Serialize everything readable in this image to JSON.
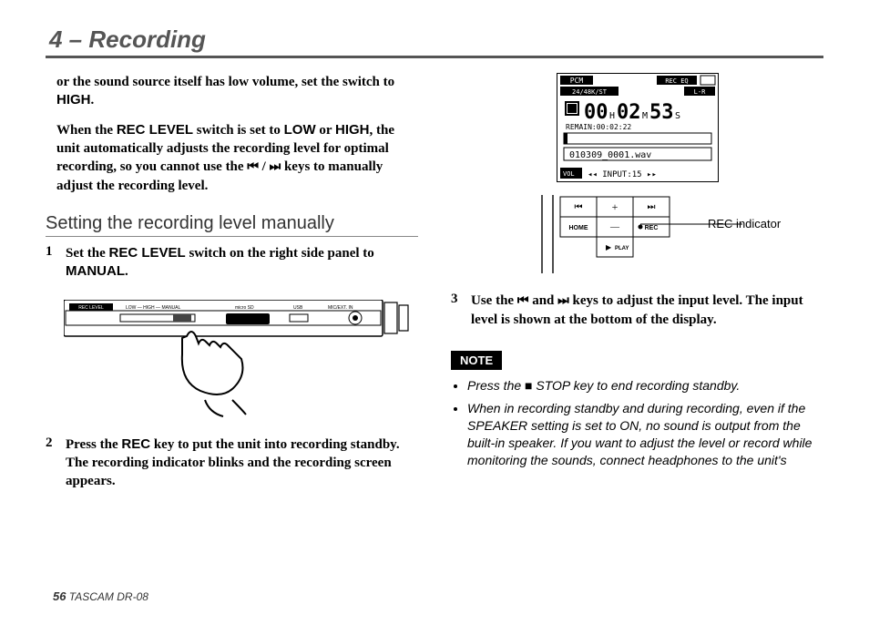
{
  "header": {
    "title": "4 – Recording"
  },
  "col1": {
    "para1_a": "or the sound source itself has low volume, set the switch to ",
    "para1_high": "HIGH",
    "para1_b": ".",
    "para2_a": "When the ",
    "para2_rec": "REC LEVEL",
    "para2_b": " switch is set to ",
    "para2_low": "LOW",
    "para2_c": " or ",
    "para2_high": "HIGH",
    "para2_d": ", the unit automatically adjusts the recording level for optimal recording, so you cannot use the ",
    "para2_e": " keys to manually adjust the recording level.",
    "subheading": "Setting the recording level manually",
    "step1_num": "1",
    "step1_a": "Set the ",
    "step1_rec": "REC LEVEL",
    "step1_b": " switch on the right side panel to ",
    "step1_manual": "MANUAL",
    "step1_c": ".",
    "device_labels": {
      "rec_level": "REC LEVEL",
      "low": "LOW",
      "high": "HIGH",
      "manual": "MANUAL",
      "microsd": "micro SD",
      "usb": "USB",
      "mic": "MIC/EXT. IN"
    },
    "step2_num": "2",
    "step2_a": "Press the ",
    "step2_rec": "REC",
    "step2_b": " key to put the unit into recording standby. The recording indicator blinks and the recording screen appears."
  },
  "col2": {
    "display": {
      "row1_left": "PCM",
      "row1_right": "REC EQ",
      "row2_left": "24/48K/ST",
      "row2_right": "L-R",
      "time_h": "00",
      "time_h_unit": "H",
      "time_m": "02",
      "time_m_unit": "M",
      "time_s": "53",
      "time_s_unit": "S",
      "remain_label": "REMAIN:",
      "remain_time": "00:02:22",
      "filename": "010309_0001.wav",
      "vol_label": "VOL",
      "input_label": "INPUT:15"
    },
    "pad": {
      "home": "HOME",
      "rec": "REC",
      "play": "PLAY",
      "plus": "+",
      "minus": "—"
    },
    "rec_indicator": "REC indicator",
    "step3_num": "3",
    "step3_a": "Use the ",
    "step3_b": " and ",
    "step3_c": " keys to adjust the input level. The input level is shown at the bottom of the display.",
    "note_label": "NOTE",
    "bullet1_a": "Press the ",
    "bullet1_b": " STOP key to end recording standby.",
    "bullet2": "When in recording standby and during recording, even if the SPEAKER setting is set to ON, no sound is output from the built-in speaker. If you want to adjust the level or record while monitoring the sounds, connect headphones to the unit's"
  },
  "footer": {
    "pageno": "56",
    "product": " TASCAM  DR-08"
  }
}
